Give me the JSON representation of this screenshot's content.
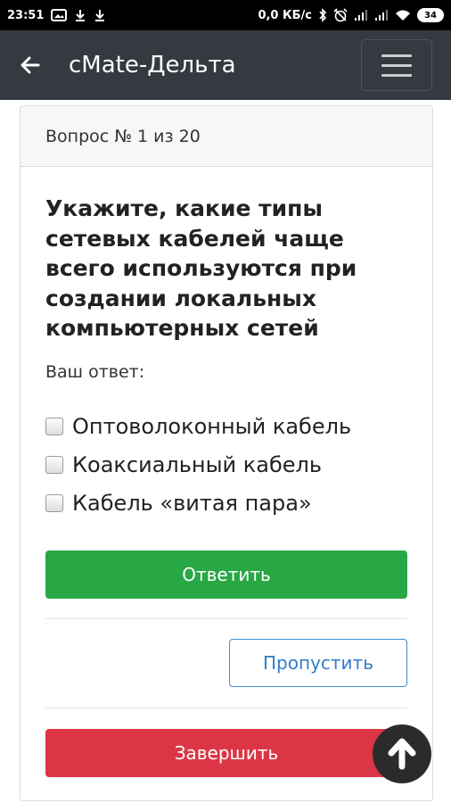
{
  "status_bar": {
    "time": "23:51",
    "speed": "0,0 КБ/с",
    "battery": "34",
    "left_icons": [
      "gallery-icon",
      "download-icon",
      "download-icon"
    ],
    "right_icons": [
      "bluetooth-icon",
      "alarm-off-icon",
      "signal-icon",
      "signal-icon",
      "wifi-icon"
    ]
  },
  "app_bar": {
    "title": "cMate-Дельта",
    "back_icon": "back-arrow-icon",
    "menu_icon": "hamburger-menu-icon"
  },
  "quiz": {
    "header": "Вопрос № 1 из 20",
    "question": "Укажите, какие типы сетевых кабелей чаще всего используются при создании локальных компьютерных сетей",
    "answer_label": "Ваш ответ:",
    "options": [
      {
        "label": "Оптоволоконный кабель",
        "checked": false
      },
      {
        "label": "Коаксиальный кабель",
        "checked": false
      },
      {
        "label": "Кабель «витая пара»",
        "checked": false
      }
    ],
    "answer_button": "Ответить",
    "skip_button": "Пропустить",
    "finish_button": "Завершить"
  },
  "colors": {
    "app_bar": "#343a40",
    "answer": "#28a745",
    "skip_border": "#3a8fd8",
    "finish": "#dc3545",
    "scroll_top": "#2b2b2b"
  },
  "scroll_top_icon": "arrow-up-icon"
}
